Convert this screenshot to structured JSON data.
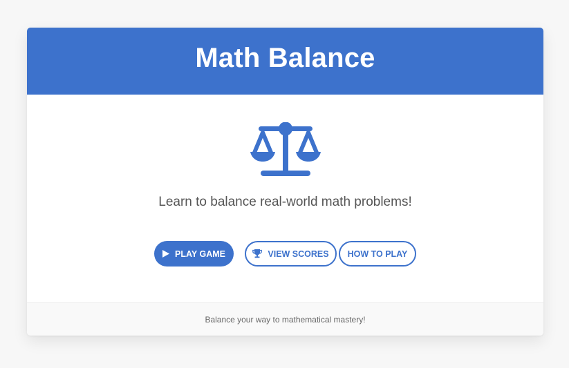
{
  "app": {
    "title": "Math Balance",
    "subtitle": "Learn to balance real-world math problems!",
    "hero_icon": "balance-scale-icon"
  },
  "buttons": {
    "play": {
      "label": "PLAY GAME",
      "icon": "play-icon"
    },
    "scores": {
      "label": "VIEW SCORES",
      "icon": "trophy-icon"
    },
    "how_to": {
      "label": "HOW TO PLAY"
    }
  },
  "footer": {
    "text": "Balance your way to mathematical mastery!"
  },
  "colors": {
    "primary": "#3d72cc",
    "background": "#f7f7f7",
    "card": "#ffffff",
    "footer": "#f9f9f9"
  }
}
